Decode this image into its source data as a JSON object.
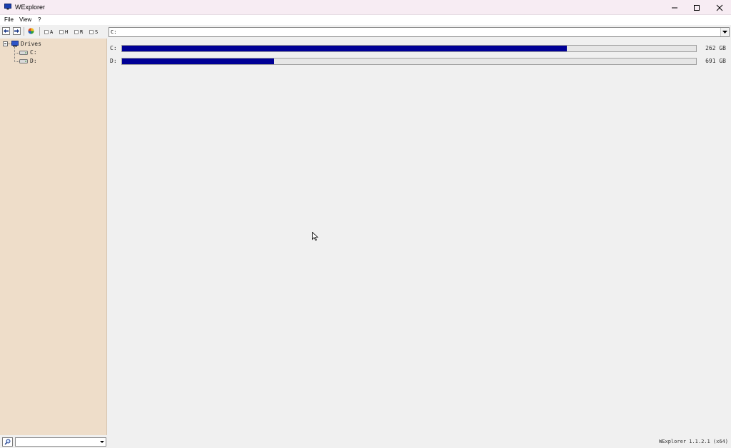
{
  "window": {
    "title": "WExplorer",
    "icon": "computer-monitor-icon"
  },
  "window_controls": [
    "minimize-icon",
    "maximize-icon",
    "close-icon"
  ],
  "menu": {
    "items": [
      "File",
      "View",
      "?"
    ]
  },
  "toolbar": {
    "buttons": [
      "back-arrow-icon",
      "forward-arrow-icon",
      "color-wheel-icon"
    ],
    "attribute_filters": [
      {
        "label": "A",
        "checked": false
      },
      {
        "label": "H",
        "checked": false
      },
      {
        "label": "R",
        "checked": false
      },
      {
        "label": "S",
        "checked": false
      }
    ]
  },
  "path": {
    "value": "C:"
  },
  "tree": {
    "root": {
      "label": "Drives",
      "expanded": true,
      "icon": "computer-icon"
    },
    "children": [
      {
        "label": "C:",
        "icon": "drive-icon"
      },
      {
        "label": "D:",
        "icon": "drive-icon"
      }
    ]
  },
  "drives": [
    {
      "letter": "C:",
      "size": "262 GB",
      "used_fraction": 0.775
    },
    {
      "letter": "D:",
      "size": "691 GB",
      "used_fraction": 0.265
    }
  ],
  "status": {
    "version": "WExplorer 1.1.2.1 (x64)",
    "search_value": ""
  },
  "colors": {
    "bar_fill": "#000096",
    "sidebar_bg": "#eeddc9",
    "titlebar_bg": "#f7ecf3"
  }
}
